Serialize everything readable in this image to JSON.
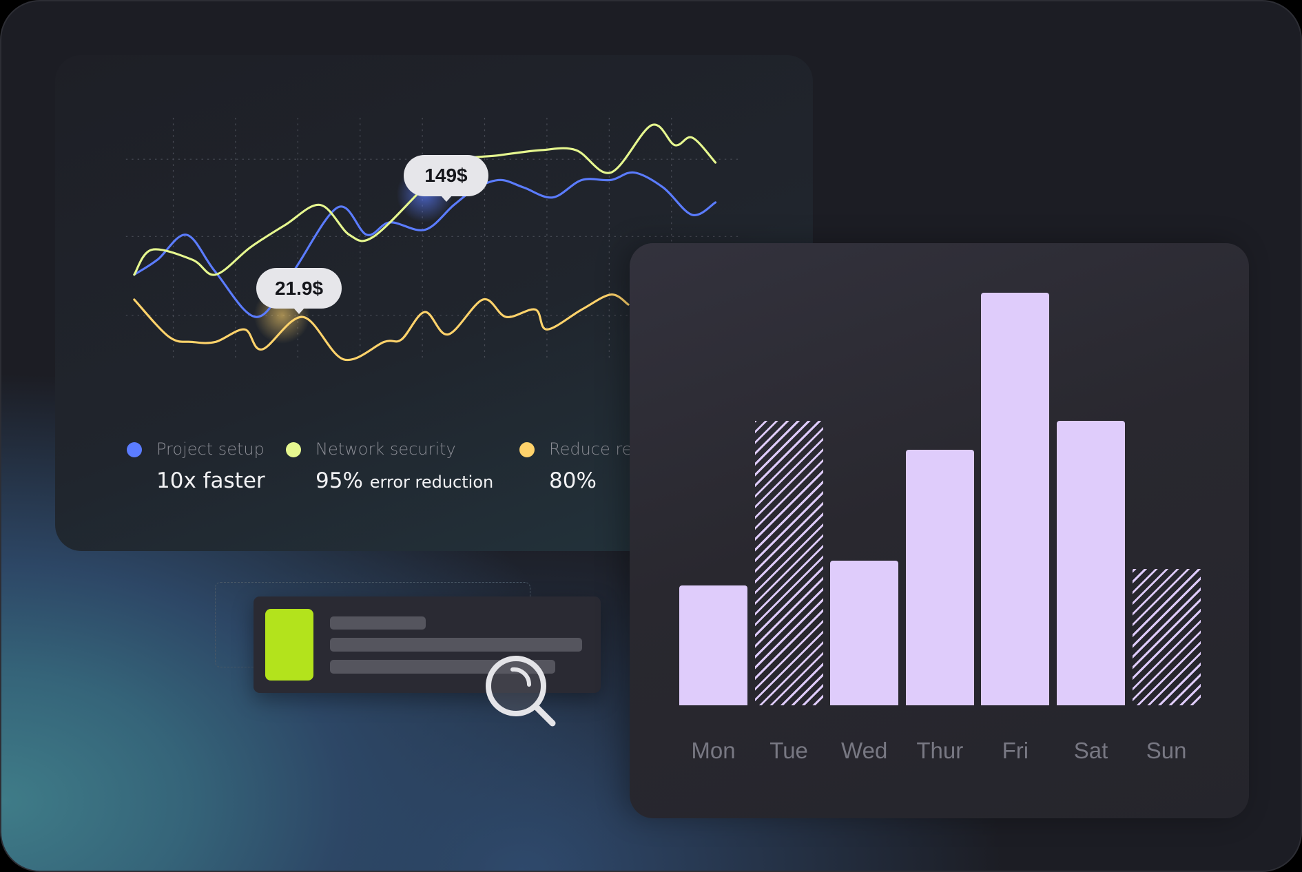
{
  "colors": {
    "project_setup": "#5b7cff",
    "network_security": "#e6f78f",
    "reduce": "#ffd36b",
    "bar_fill": "#dfccfb",
    "card_accent": "#b3e31c"
  },
  "line_chart": {
    "tooltips": [
      {
        "label": "149$",
        "series": "Network security"
      },
      {
        "label": "21.9$",
        "series": "Reduce res"
      }
    ],
    "legend": [
      {
        "label": "Project setup",
        "value": "10x faster",
        "value_suffix": "",
        "color": "#5b7cff"
      },
      {
        "label": "Network security",
        "value": "95%",
        "value_suffix": "error reduction",
        "color": "#e6f78f"
      },
      {
        "label": "Reduce res",
        "value": "80%",
        "value_suffix": "",
        "color": "#ffd36b"
      }
    ]
  },
  "search_card": {
    "icon": "magnifier-icon"
  },
  "chart_data": [
    {
      "type": "line",
      "grid": true,
      "legend": "bottom",
      "series": [
        {
          "name": "Project setup",
          "color": "#5b7cff",
          "x": [
            0,
            4,
            9,
            14,
            21,
            27,
            35,
            40,
            44,
            50,
            55,
            59,
            63,
            67,
            72,
            77,
            82,
            86,
            91,
            96,
            100
          ],
          "y": [
            37,
            43,
            53,
            38,
            20,
            37,
            64,
            53,
            58,
            55,
            65,
            72,
            75,
            72,
            68,
            75,
            75,
            78,
            72,
            61,
            66
          ]
        },
        {
          "name": "Network security",
          "color": "#e6f78f",
          "x": [
            0,
            3,
            10,
            14,
            20,
            26,
            32,
            37,
            41,
            49,
            54,
            63,
            70,
            76,
            82,
            89,
            93,
            96,
            100
          ],
          "y": [
            37,
            47,
            43,
            37,
            48,
            57,
            65,
            53,
            52,
            70,
            82,
            85,
            87,
            87,
            78,
            97,
            89,
            92,
            82
          ]
        },
        {
          "name": "Reduce res",
          "color": "#ffd36b",
          "x": [
            0,
            6,
            10,
            14,
            19,
            22,
            29,
            36,
            43,
            46,
            50,
            54,
            60,
            64,
            69,
            71,
            77,
            82,
            85
          ],
          "y": [
            27,
            12,
            10,
            10,
            15,
            7,
            20,
            3,
            10,
            11,
            22,
            13,
            27,
            20,
            23,
            15,
            23,
            29,
            25
          ]
        }
      ]
    },
    {
      "type": "bar",
      "categories": [
        "Mon",
        "Tue",
        "Wed",
        "Thur",
        "Fri",
        "Sat",
        "Sun"
      ],
      "values": [
        29,
        69,
        35,
        62,
        100,
        69,
        33
      ],
      "hatched": [
        false,
        true,
        false,
        false,
        false,
        false,
        true
      ],
      "ylim": [
        0,
        100
      ],
      "grid": false
    }
  ]
}
